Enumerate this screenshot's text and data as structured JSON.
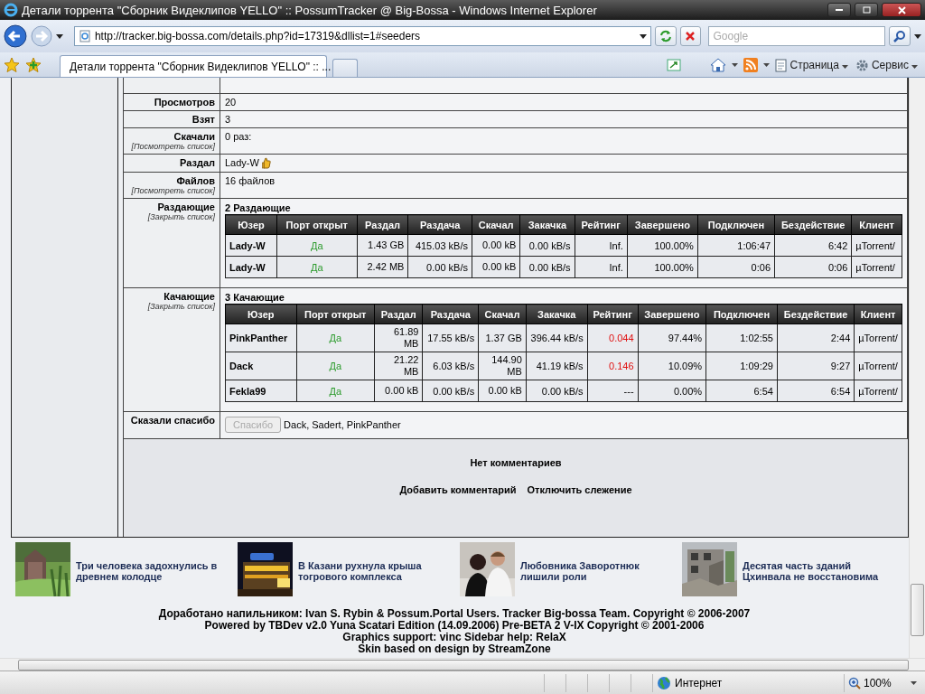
{
  "window": {
    "title": "Детали торрента \"Сборник Видеклипов YELLO\" :: PossumTracker @ Big-Bossa - Windows Internet Explorer"
  },
  "address_bar": {
    "url": "http://tracker.big-bossa.com/details.php?id=17319&dllist=1#seeders"
  },
  "search": {
    "placeholder": "Google"
  },
  "tabs": [
    {
      "label": "Детали торрента \"Сборник Видеклипов YELLO\" :: ...",
      "selected": true
    }
  ],
  "toolbar": [
    {
      "label": "Страница"
    },
    {
      "label": "Сервис"
    }
  ],
  "details": [
    {
      "kind": "text",
      "label": "Просмотров",
      "value": "20"
    },
    {
      "kind": "text",
      "label": "Взят",
      "value": "3"
    },
    {
      "kind": "text",
      "label": "Скачали",
      "link": "[Посмотреть список]",
      "value": "0 раз:"
    },
    {
      "kind": "user",
      "label": "Раздал",
      "value": "Lady-W"
    },
    {
      "kind": "text",
      "label": "Файлов",
      "link": "[Посмотреть список]",
      "value": "16 файлов"
    },
    {
      "kind": "peers",
      "label": "Раздающие",
      "link": "[Закрыть список]",
      "title": "2 Раздающие",
      "columns": [
        "Юзер",
        "Порт открыт",
        "Раздал",
        "Раздача",
        "Скачал",
        "Закачка",
        "Рейтинг",
        "Завершено",
        "Подключен",
        "Бездействие",
        "Клиент"
      ],
      "rows": [
        {
          "low_ratio": false,
          "cells": [
            "Lady-W",
            "Да",
            "1.43 GB",
            "415.03 kB/s",
            "0.00 kB",
            "0.00 kB/s",
            "Inf.",
            "100.00%",
            "1:06:47",
            "6:42",
            "µTorrent/"
          ]
        },
        {
          "low_ratio": false,
          "cells": [
            "Lady-W",
            "Да",
            "2.42 MB",
            "0.00 kB/s",
            "0.00 kB",
            "0.00 kB/s",
            "Inf.",
            "100.00%",
            "0:06",
            "0:06",
            "µTorrent/"
          ]
        }
      ]
    },
    {
      "kind": "peers",
      "label": "Качающие",
      "link": "[Закрыть список]",
      "title": "3 Качающие",
      "columns": [
        "Юзер",
        "Порт открыт",
        "Раздал",
        "Раздача",
        "Скачал",
        "Закачка",
        "Рейтинг",
        "Завершено",
        "Подключен",
        "Бездействие",
        "Клиент"
      ],
      "rows": [
        {
          "low_ratio": true,
          "cells": [
            "PinkPanther",
            "Да",
            "61.89 MB",
            "17.55 kB/s",
            "1.37 GB",
            "396.44 kB/s",
            "0.044",
            "97.44%",
            "1:02:55",
            "2:44",
            "µTorrent/"
          ]
        },
        {
          "low_ratio": true,
          "cells": [
            "Dack",
            "Да",
            "21.22 MB",
            "6.03 kB/s",
            "144.90 MB",
            "41.19 kB/s",
            "0.146",
            "10.09%",
            "1:09:29",
            "9:27",
            "µTorrent/"
          ]
        },
        {
          "low_ratio": false,
          "cells": [
            "Fekla99",
            "Да",
            "0.00 kB",
            "0.00 kB/s",
            "0.00 kB",
            "0.00 kB/s",
            "---",
            "0.00%",
            "6:54",
            "6:54",
            "µTorrent/"
          ]
        }
      ]
    },
    {
      "kind": "thanks",
      "label": "Сказали спасибо",
      "button": {
        "label": "Спасибо",
        "disabled": true
      },
      "value": "Dack, Sadert, PinkPanther"
    }
  ],
  "comments": {
    "message": "Нет комментариев",
    "links": [
      "Добавить комментарий",
      "Отключить слежение"
    ]
  },
  "news": [
    {
      "kind": "picture",
      "title": "Три человека задохнулись в древнем колодце"
    },
    {
      "kind": "picture",
      "title": "В Казани рухнула крыша тогрового комплекса"
    },
    {
      "kind": "picture",
      "title": "Любовника Заворотнюк лишили роли"
    },
    {
      "kind": "picture",
      "title": "Десятая часть зданий Цхинвала не восстановима"
    }
  ],
  "footer": [
    "Доработано напильником: Ivan S. Rybin & Possum.Portal Users. Tracker Big-bossa Team. Copyright © 2006-2007",
    "Powered by TBDev v2.0 Yuna Scatari Edition (14.09.2006) Pre-BETA 2 V-IX Copyright © 2001-2006",
    "Graphics support: vinc Sidebar help: RelaX",
    "Skin based on design by StreamZone"
  ],
  "status_bar": {
    "zone": "Интернет",
    "zoom": "100%"
  }
}
